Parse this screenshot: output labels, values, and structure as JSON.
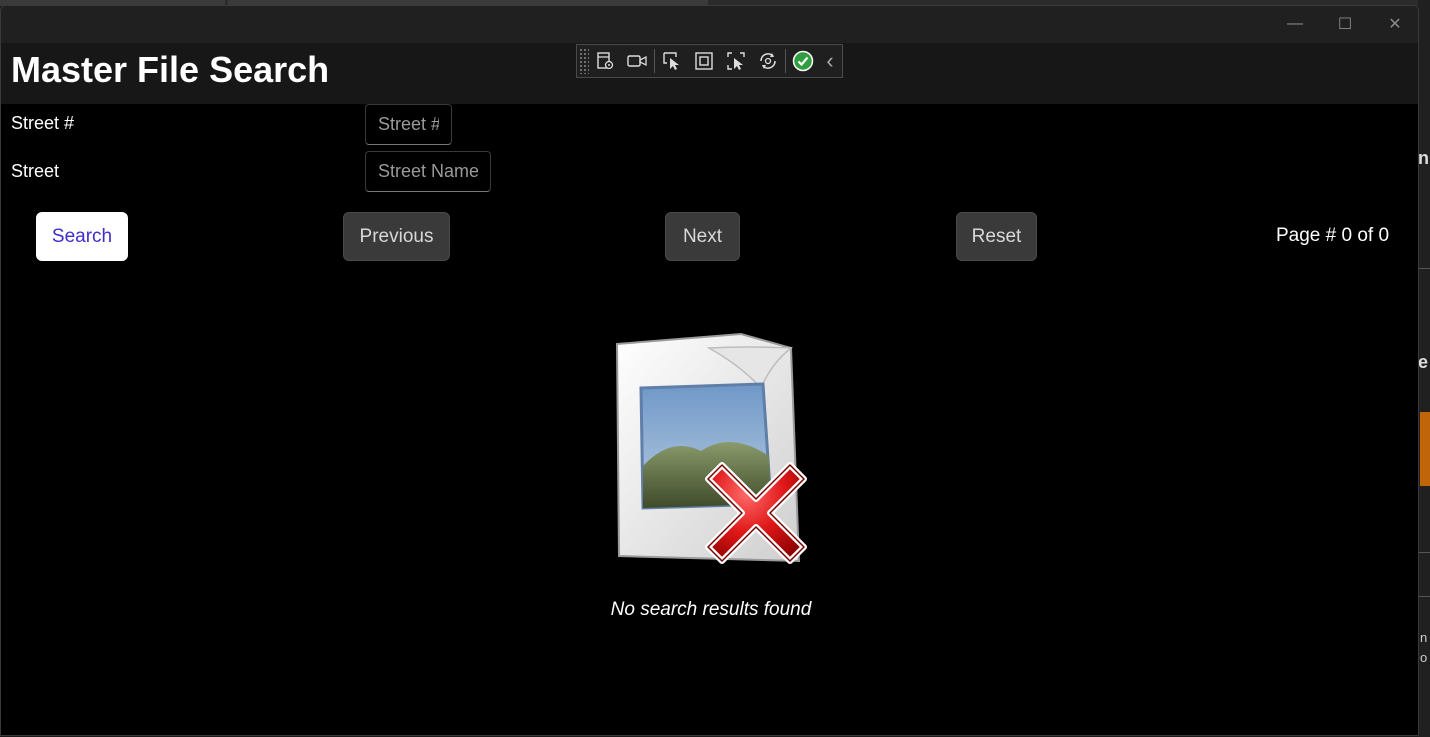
{
  "window": {
    "controls": {
      "minimize": "—",
      "maximize": "☐",
      "close": "✕"
    }
  },
  "header": {
    "title": "Master File Search"
  },
  "toolbar": {
    "icons": [
      "live-visual-tree-icon",
      "record-icon",
      "select-element-icon",
      "layout-adorners-icon",
      "track-focus-icon",
      "hot-reload-icon",
      "binding-check-icon",
      "collapse-icon"
    ],
    "collapse_glyph": "‹"
  },
  "form": {
    "street_number": {
      "label": "Street #",
      "placeholder": "Street #",
      "value": ""
    },
    "street_name": {
      "label": "Street",
      "placeholder": "Street Name",
      "value": ""
    }
  },
  "actions": {
    "search": "Search",
    "previous": "Previous",
    "next": "Next",
    "reset": "Reset"
  },
  "pagination": {
    "text": "Page # 0 of 0",
    "current": 0,
    "total": 0
  },
  "results": {
    "empty_message": "No search results found"
  },
  "colors": {
    "accent_text": "#3d2fc8",
    "background": "#000000",
    "secondary_button": "#3a3a3a"
  }
}
